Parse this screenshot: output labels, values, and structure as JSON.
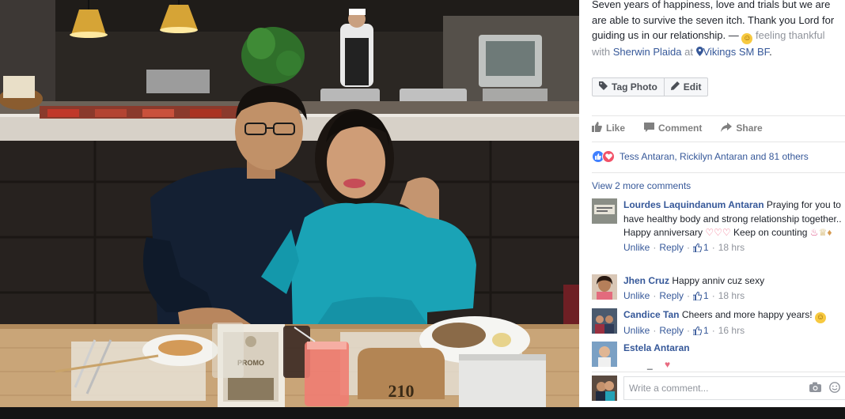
{
  "photo": {
    "placard_number": "210",
    "promo_heading": "PROMO"
  },
  "caption": {
    "text": "Seven years of happiness, love and trials but we are are able to survive the seven itch. Thank you Lord for guiding us in our relationship. —",
    "feeling_prefix": "feeling",
    "feeling": "thankful",
    "with_word": "with",
    "tagged": "Sherwin Plaida",
    "at_word": "at",
    "location": "Vikings SM BF",
    "end": "."
  },
  "photo_buttons": {
    "tag_photo": "Tag Photo",
    "edit": "Edit"
  },
  "actions": {
    "like": "Like",
    "comment": "Comment",
    "share": "Share"
  },
  "reactions": {
    "names": "Tess Antaran, Rickilyn Antaran and 81 others"
  },
  "view_more": "View 2 more comments",
  "comments": [
    {
      "author": "Lourdes Laquindanum Antaran",
      "text_a": "Praying for you to have healthy body and strong relationship together.. Happy anniversary",
      "text_b": "Keep on counting",
      "reply_actions": {
        "unlike": "Unlike",
        "reply": "Reply",
        "likes": "1",
        "time": "18 hrs"
      }
    },
    {
      "author": "Jhen Cruz",
      "text_a": "Happy anniv cuz sexy",
      "reply_actions": {
        "unlike": "Unlike",
        "reply": "Reply",
        "likes": "1",
        "time": "18 hrs"
      }
    },
    {
      "author": "Candice Tan",
      "text_a": "Cheers and more happy years!",
      "reply_actions": {
        "unlike": "Unlike",
        "reply": "Reply",
        "likes": "1",
        "time": "16 hrs"
      }
    },
    {
      "author": "Estela Antaran",
      "text_a": "_"
    }
  ],
  "composer": {
    "placeholder": "Write a comment..."
  },
  "colors": {
    "link": "#365899",
    "muted": "#90949c",
    "like_blue": "#4080ff",
    "love_red": "#f25268"
  },
  "icons": [
    "tag-icon",
    "pencil-icon",
    "thumbs-up-icon",
    "speech-bubble-icon",
    "share-arrow-icon",
    "location-pin-icon",
    "camera-icon",
    "smiley-icon"
  ]
}
